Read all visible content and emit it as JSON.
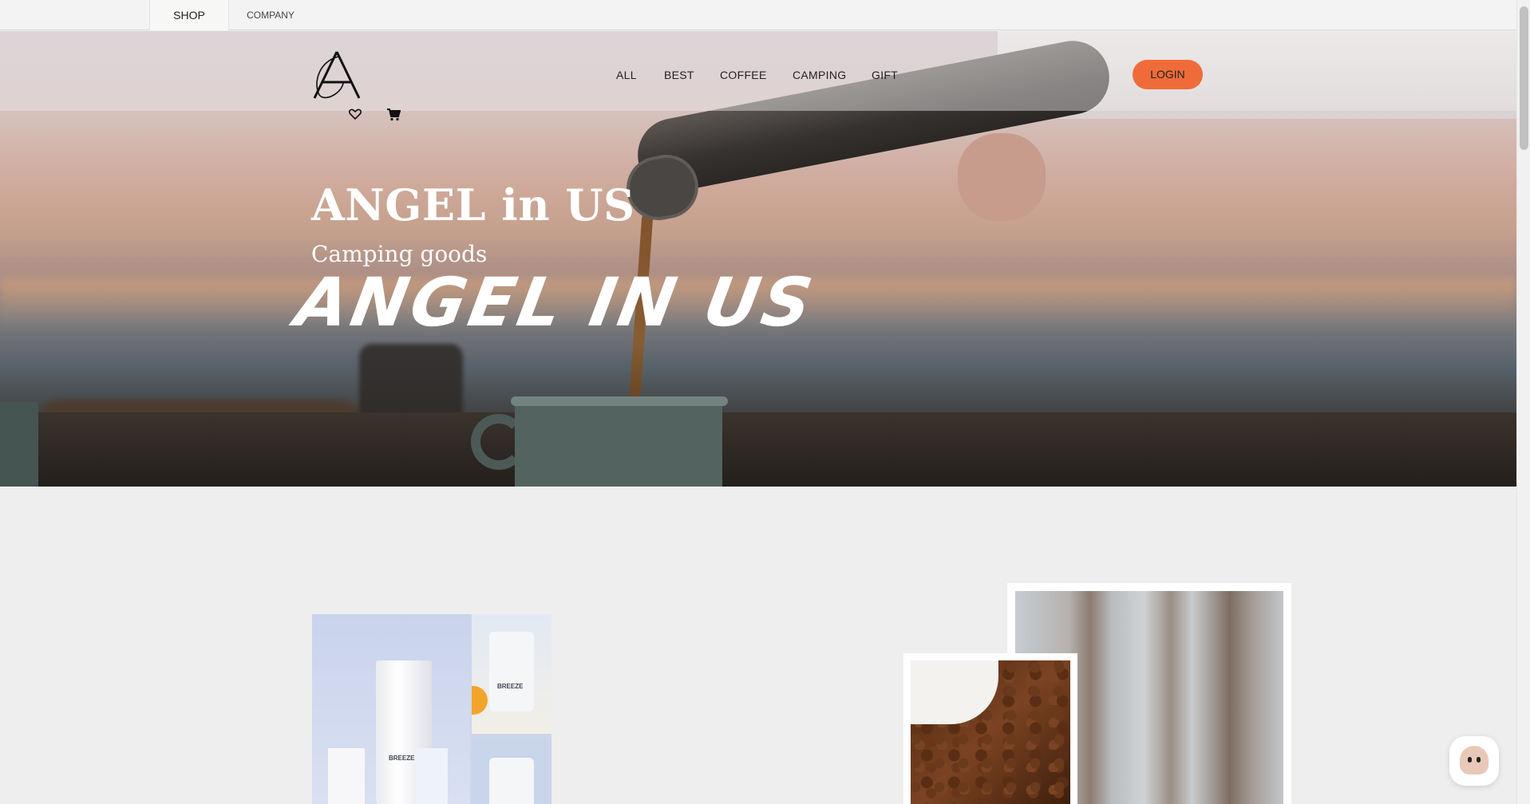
{
  "top_tabs": {
    "shop": "SHOP",
    "company": "COMPANY"
  },
  "header": {
    "nav": [
      "ALL",
      "BEST",
      "COFFEE",
      "CAMPING",
      "GIFT"
    ],
    "login": "LOGIN",
    "icons": [
      "heart-icon",
      "cart-icon"
    ]
  },
  "hero": {
    "title": "ANGEL in US",
    "subtitle": "Camping goods",
    "script": "ANGEL IN US"
  },
  "products": {
    "packaging_label_1": "BREEZE",
    "packaging_label_2": "BREEZE"
  },
  "colors": {
    "accent": "#ef6c3a",
    "background": "#eeeeee"
  }
}
